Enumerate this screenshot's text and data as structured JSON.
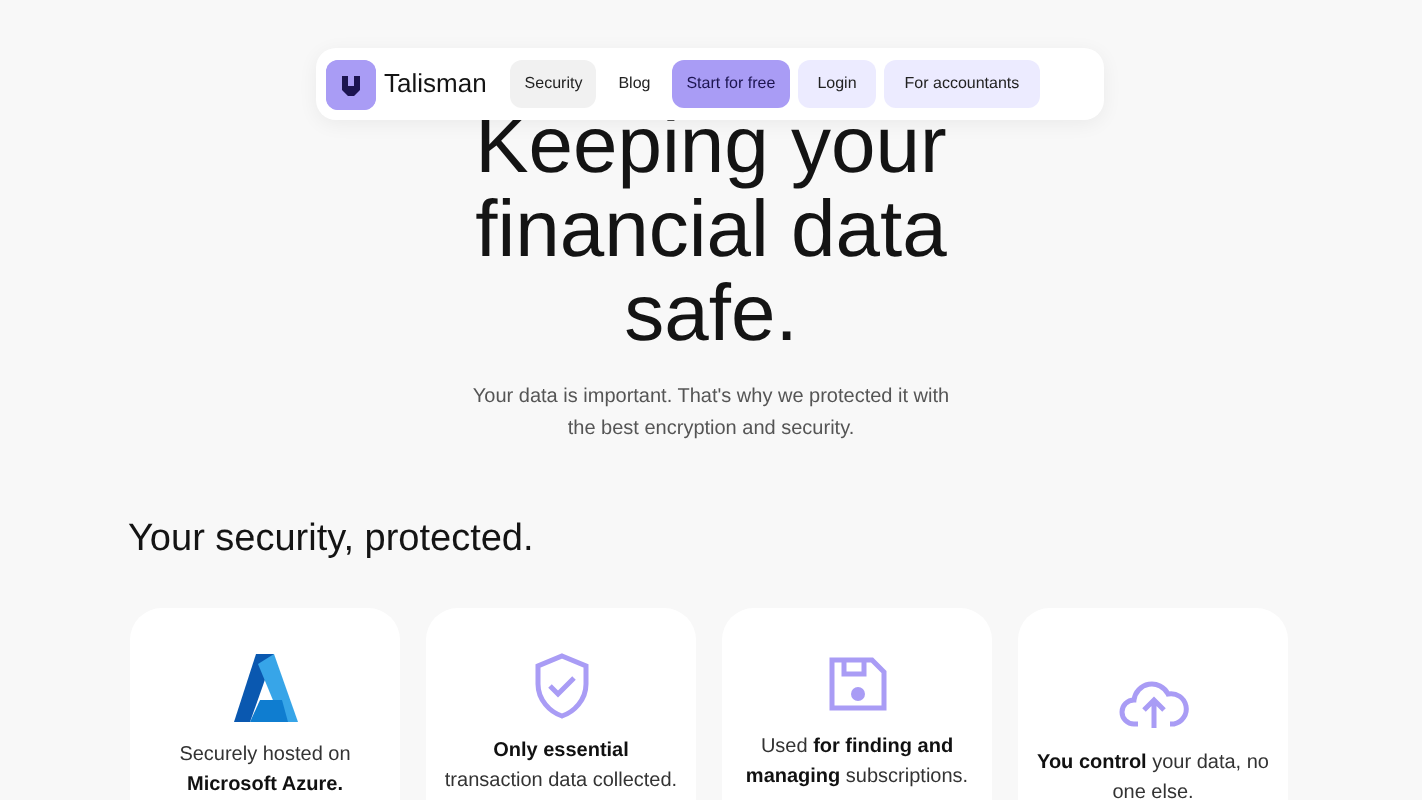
{
  "nav": {
    "brand": "Talisman",
    "links": [
      {
        "label": "Security",
        "kind": "soft"
      },
      {
        "label": "Blog",
        "kind": "plain"
      },
      {
        "label": "Start for free",
        "kind": "primary"
      },
      {
        "label": "Login",
        "kind": "light"
      },
      {
        "label": "For accountants",
        "kind": "light"
      }
    ]
  },
  "hero": {
    "title_lines": [
      "Keeping your",
      "financial data",
      "safe."
    ],
    "subtitle_lines": [
      "Your data is important. That's why we protected it with",
      "the best encryption and security."
    ]
  },
  "section_title": "Your security, protected.",
  "cards": [
    {
      "kind": "azure",
      "text": "Securely hosted on **Microsoft Azure.**"
    },
    {
      "kind": "shield",
      "text": "**Only essential** transaction data collected."
    },
    {
      "kind": "disk",
      "text": "Used **for finding and managing** subscriptions."
    },
    {
      "kind": "cloud",
      "text": "**You control** your data, no one else."
    }
  ]
}
